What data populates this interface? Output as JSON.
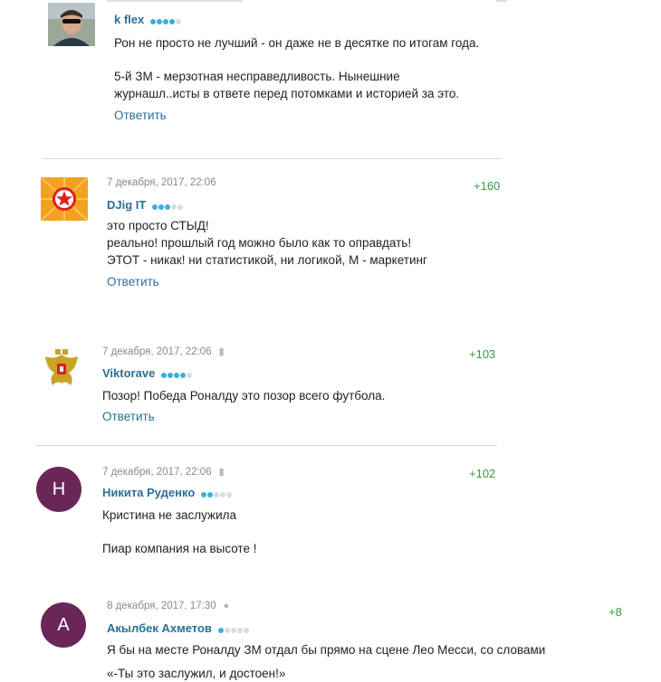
{
  "comments": [
    {
      "username": "k flex",
      "rating_dots": 4,
      "paragraphs": [
        "Рон не просто не лучший - он даже не в десятке по итогам года.",
        "5-й ЗМ - мерзотная несправедливость. Нынешние",
        "журнашл..исты в ответе перед потомками и историей за это."
      ],
      "reply_label": "Ответить"
    },
    {
      "date": "7 декабря, 2017, 22:06",
      "username": "DJig IT",
      "rating_dots": 3,
      "score": "+160",
      "paragraphs": [
        "это просто СТЫД!",
        "реально! прошлый год можно было как то оправдать!",
        "ЭТОТ - никак! ни статистикой, ни логикой, М - маркетинг"
      ],
      "reply_label": "Ответить"
    },
    {
      "date": "7 декабря, 2017, 22:06",
      "username": "Viktorave",
      "rating_dots": 4,
      "score": "+103",
      "paragraphs": [
        "Позор! Победа Роналду это позор всего футбола."
      ],
      "reply_label": "Ответить"
    },
    {
      "date": "7 декабря, 2017, 22:06",
      "username": "Никита Руденко",
      "avatar_letter": "Н",
      "rating_dots": 2,
      "score": "+102",
      "paragraphs": [
        "Кристина не заслужила",
        "Пиар компания на высоте !"
      ]
    },
    {
      "date": "8 декабря, 2017, 17:30",
      "username": "Акылбек Ахметов",
      "avatar_letter": "А",
      "rating_dots": 1,
      "score": "+8",
      "paragraphs": [
        "Я бы на месте Роналду ЗМ отдал бы прямо на сцене Лео Месси, со словами",
        "«-Ты это заслужил, и достоен!»"
      ]
    }
  ],
  "colors": {
    "username": "#2b6f94",
    "reply": "#2b6f94",
    "score": "#3a9a3a",
    "dot_on": "#3ab0d8",
    "dot_off": "#d4dde2",
    "avatar_purple": "#6a2657"
  }
}
